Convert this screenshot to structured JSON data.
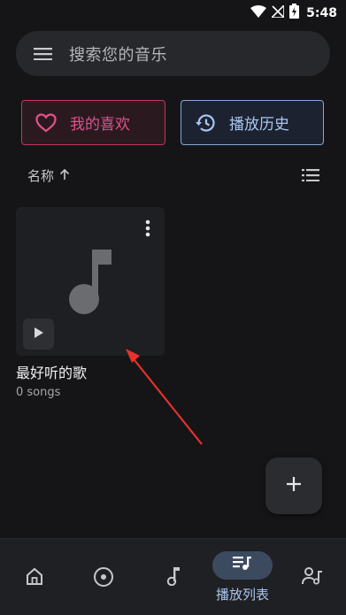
{
  "status_bar": {
    "time": "5:48",
    "icons": [
      "wifi-icon",
      "signal-muted-icon",
      "battery-charging-icon"
    ]
  },
  "search": {
    "placeholder": "搜索您的音乐"
  },
  "quick_actions": {
    "favorites_label": "我的喜欢",
    "history_label": "播放历史"
  },
  "sort": {
    "label": "名称",
    "direction": "ascending"
  },
  "playlists": [
    {
      "title": "最好听的歌",
      "subtitle": "0 songs"
    }
  ],
  "bottom_nav": {
    "items": [
      "home-icon",
      "album-icon",
      "song-icon",
      "playlist-icon",
      "artist-icon"
    ],
    "active_label": "播放列表"
  },
  "colors": {
    "background": "#151517",
    "favorite_accent": "#e4508a",
    "history_accent": "#a9c6f2",
    "annotation_arrow": "#e8322c"
  }
}
